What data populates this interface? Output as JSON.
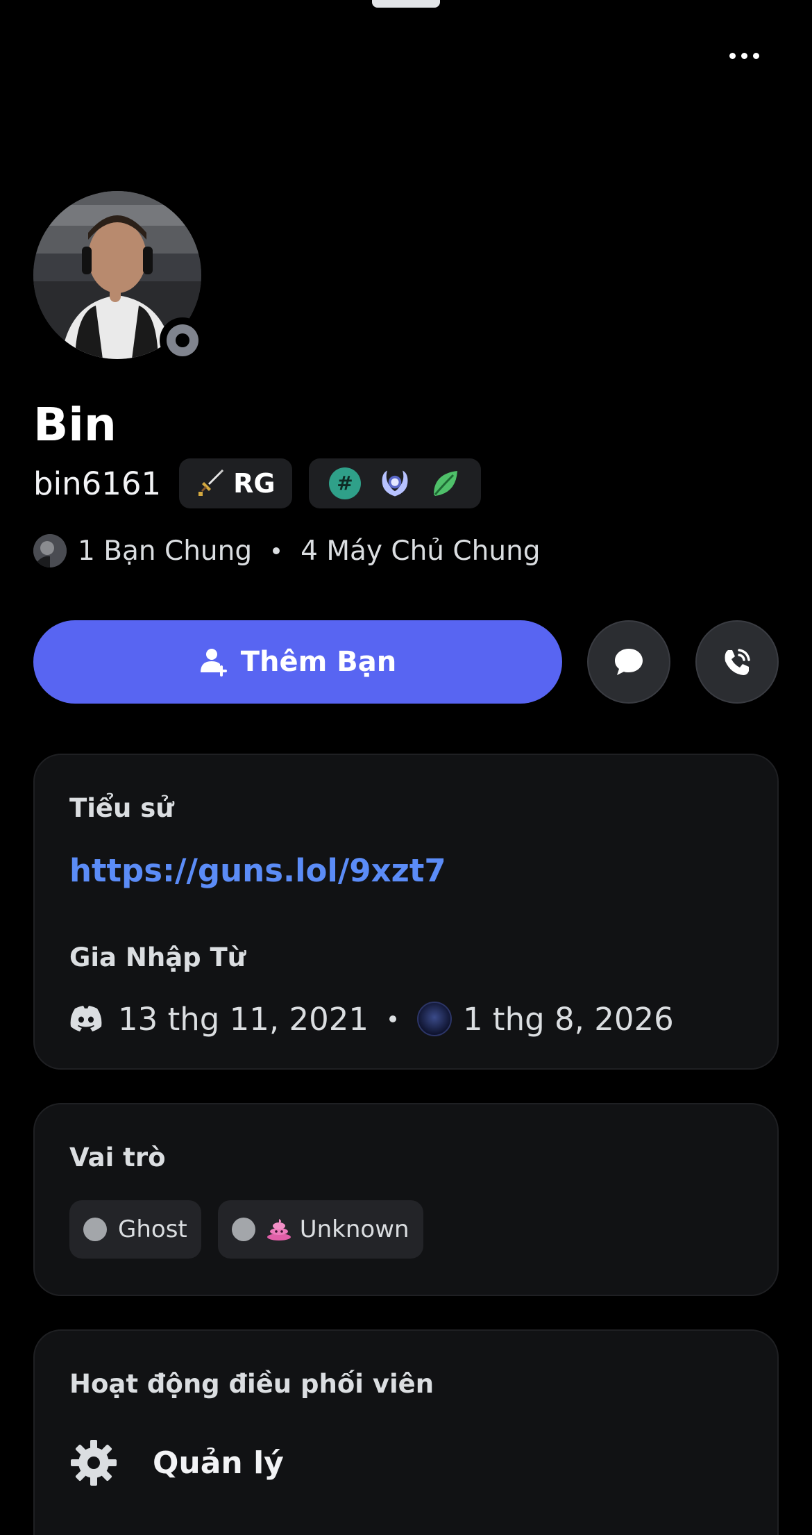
{
  "profile": {
    "display_name": "Bin",
    "username": "bin6161",
    "guild_tag": "RG",
    "mutual_friends": "1 Bạn Chung",
    "mutual_servers": "4 Máy Chủ Chung"
  },
  "actions": {
    "add_friend_label": "Thêm Bạn"
  },
  "bio": {
    "title": "Tiểu sử",
    "link": "https://guns.lol/9xzt7",
    "member_since_title": "Gia Nhập Từ",
    "discord_join_date": "13 thg 11, 2021",
    "server_join_date": "1 thg 8, 2026"
  },
  "roles": {
    "title": "Vai trò",
    "items": [
      {
        "label": "Ghost",
        "color": "#a3a6aa"
      },
      {
        "label": "Unknown",
        "color": "#a3a6aa"
      }
    ]
  },
  "moderation": {
    "title": "Hoạt động điều phối viên",
    "item_label": "Quản lý"
  },
  "colors": {
    "accent": "#5865f2",
    "link": "#5b8cf7",
    "status_offline": "#80848e",
    "card_bg": "#111214"
  },
  "icons": [
    "more-icon",
    "status-offline-icon",
    "sword-icon",
    "hashtag-badge-icon",
    "laurel-badge-icon",
    "leaf-badge-icon",
    "add-user-icon",
    "chat-bubble-icon",
    "phone-call-icon",
    "discord-logo-icon",
    "server-icon",
    "poop-emoji-icon",
    "gear-icon"
  ]
}
